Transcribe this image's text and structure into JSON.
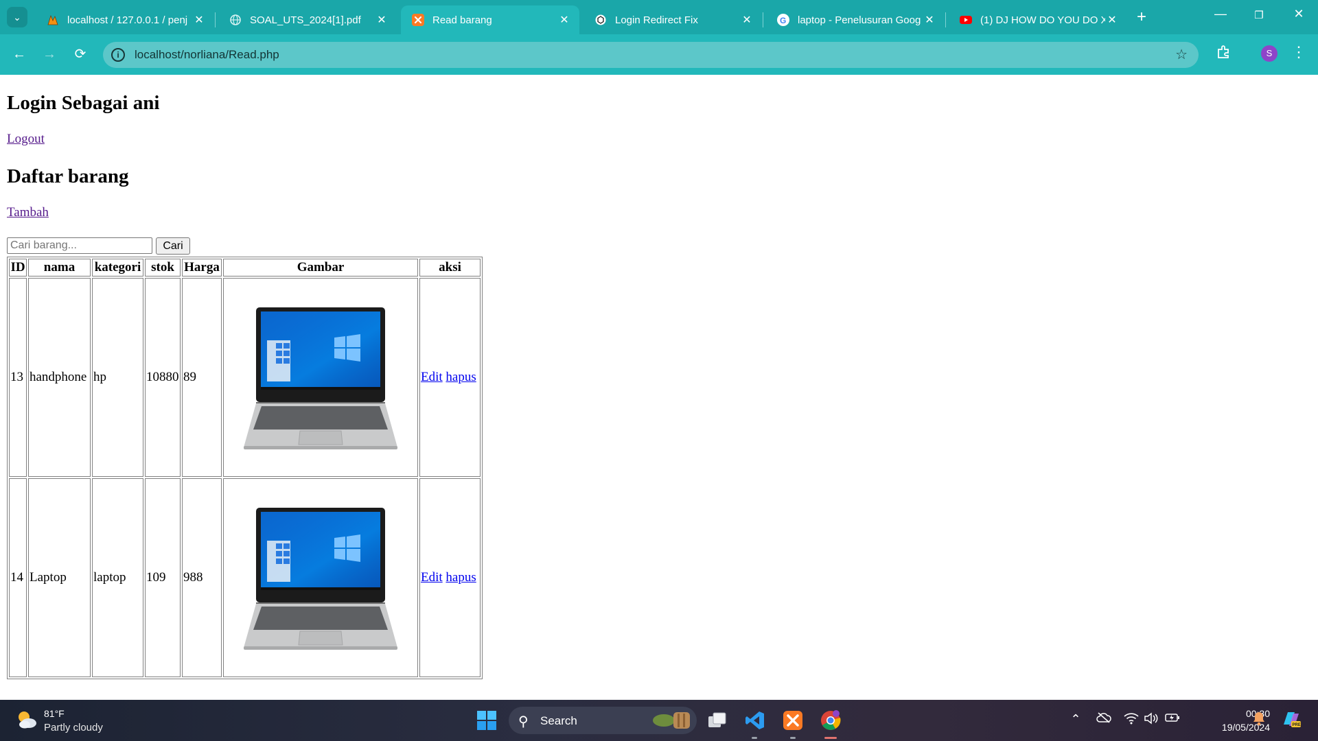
{
  "browser": {
    "tabs": [
      {
        "title": "localhost / 127.0.0.1 / penj",
        "active": false
      },
      {
        "title": "SOAL_UTS_2024[1].pdf",
        "active": false
      },
      {
        "title": "Read barang",
        "active": true
      },
      {
        "title": "Login Redirect Fix",
        "active": false
      },
      {
        "title": "laptop - Penelusuran Goog",
        "active": false
      },
      {
        "title": "(1) DJ HOW DO YOU DO X",
        "active": false
      }
    ],
    "url": "localhost/norliana/Read.php",
    "profile_initial": "S",
    "accent_color": "#22b8ba"
  },
  "page": {
    "login_heading": "Login Sebagai ani",
    "logout_link": "Logout",
    "list_heading": "Daftar barang",
    "add_link": "Tambah",
    "search": {
      "placeholder": "Cari barang...",
      "value": "",
      "button_label": "Cari"
    },
    "table": {
      "headers": [
        "ID",
        "nama",
        "kategori",
        "stok",
        "Harga",
        "Gambar",
        "aksi"
      ],
      "rows": [
        {
          "id": "13",
          "nama": "handphone",
          "kategori": "hp",
          "stok": "10880",
          "harga": "89",
          "gambar": "laptop-image",
          "edit": "Edit",
          "hapus": "hapus"
        },
        {
          "id": "14",
          "nama": "Laptop",
          "kategori": "laptop",
          "stok": "109",
          "harga": "988",
          "gambar": "laptop-image",
          "edit": "Edit",
          "hapus": "hapus"
        }
      ]
    }
  },
  "taskbar": {
    "weather_temp": "81°F",
    "weather_desc": "Partly cloudy",
    "search_label": "Search",
    "time": "00:30",
    "date": "19/05/2024"
  }
}
